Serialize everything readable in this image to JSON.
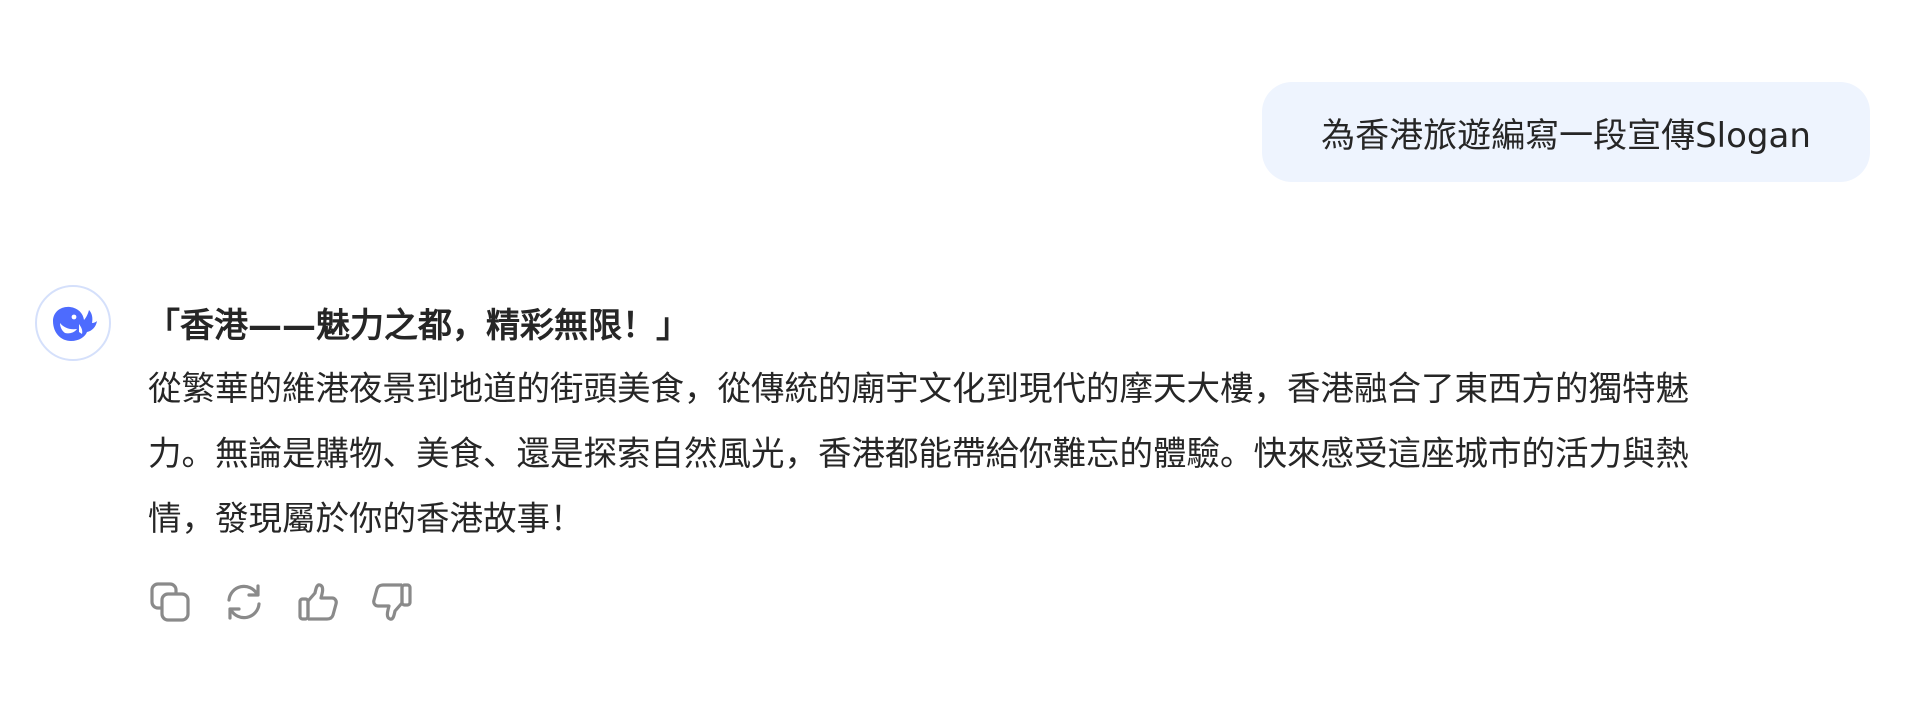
{
  "user_message": {
    "text": "為香港旅遊編寫一段宣傳Slogan"
  },
  "assistant_message": {
    "avatar_icon": "deepseek-whale-logo",
    "slogan": "「香港——魅力之都，精彩無限！」",
    "body_lines": [
      "從繁華的維港夜景到地道的街頭美食，從傳統的廟宇文化到現代的摩天大樓，香港融合了東西方的獨特魅",
      "力。無論是購物、美食、還是探索自然風光，香港都能帶給你難忘的體驗。快來感受這座城市的活力與熱",
      "情，發現屬於你的香港故事！"
    ]
  },
  "actions": {
    "icons": [
      "copy-icon",
      "regenerate-icon",
      "thumbs-up-icon",
      "thumbs-down-icon"
    ]
  },
  "colors": {
    "user_bubble_bg": "#eef4fe",
    "text": "#262626",
    "brand_blue": "#4d6bfe",
    "icon_gray": "#8a8a8a",
    "avatar_border": "#d5e0fb"
  }
}
